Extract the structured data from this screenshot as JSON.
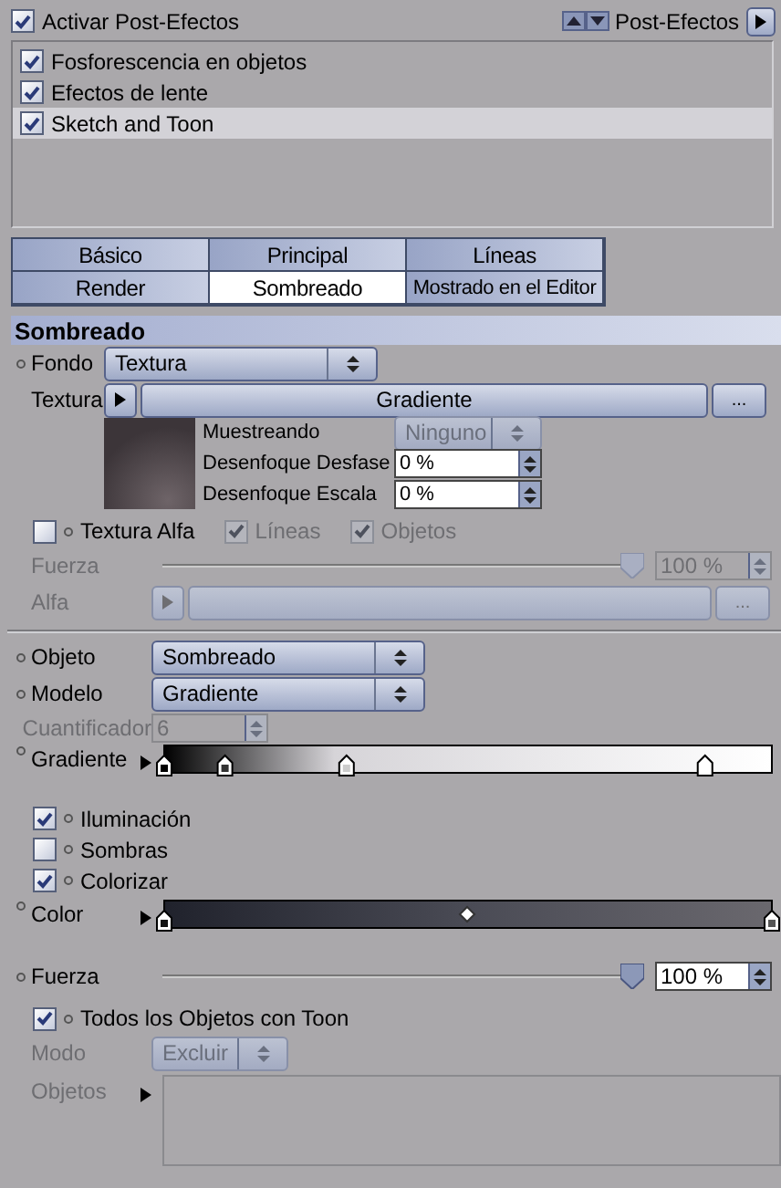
{
  "header": {
    "enable": {
      "label": "Activar Post-Efectos",
      "checked": true
    },
    "menu_label": "Post-Efectos"
  },
  "effects": [
    {
      "label": "Fosforescencia en objetos",
      "checked": true,
      "selected": false
    },
    {
      "label": "Efectos de lente",
      "checked": true,
      "selected": false
    },
    {
      "label": "Sketch and Toon",
      "checked": true,
      "selected": true
    }
  ],
  "tabs": [
    {
      "label": "Básico",
      "selected": false
    },
    {
      "label": "Principal",
      "selected": false
    },
    {
      "label": "Líneas",
      "selected": false
    },
    {
      "label": "Render",
      "selected": false
    },
    {
      "label": "Sombreado",
      "selected": true
    },
    {
      "label": "Mostrado en el Editor",
      "selected": false
    }
  ],
  "section_title": "Sombreado",
  "background": {
    "label": "Fondo",
    "value": "Textura"
  },
  "texture": {
    "label": "Textura",
    "value": "Gradiente",
    "more": "...",
    "sampling": {
      "label": "Muestreando",
      "value": "Ninguno",
      "disabled": true
    },
    "blur_offset": {
      "label": "Desenfoque Desfase",
      "value": "0 %"
    },
    "blur_scale": {
      "label": "Desenfoque Escala",
      "value": "0 %"
    }
  },
  "alpha_texture": {
    "label": "Textura Alfa",
    "checked": false,
    "options": [
      {
        "label": "Líneas",
        "checked": true,
        "disabled": true
      },
      {
        "label": "Objetos",
        "checked": true,
        "disabled": true
      }
    ]
  },
  "alpha_strength": {
    "label": "Fuerza",
    "level": 1,
    "value": "100 %",
    "disabled": true
  },
  "alpha": {
    "label": "Alfa",
    "more": "...",
    "disabled": true
  },
  "object": {
    "label": "Objeto",
    "value": "Sombreado"
  },
  "model": {
    "label": "Modelo",
    "value": "Gradiente"
  },
  "quantizer": {
    "label": "Cuantificador",
    "value": "6",
    "disabled": true
  },
  "gradient": {
    "label": "Gradiente"
  },
  "toggles": [
    {
      "label": "Iluminación",
      "checked": true
    },
    {
      "label": "Sombras",
      "checked": false
    },
    {
      "label": "Colorizar",
      "checked": true
    }
  ],
  "color": {
    "label": "Color"
  },
  "strength": {
    "label": "Fuerza",
    "level": 1,
    "value": "100 %",
    "disabled": false
  },
  "all_objects": {
    "label": "Todos los Objetos con Toon",
    "checked": true
  },
  "mode": {
    "label": "Modo",
    "value": "Excluir",
    "disabled": true
  },
  "objects": {
    "label": "Objetos",
    "disabled": true
  }
}
